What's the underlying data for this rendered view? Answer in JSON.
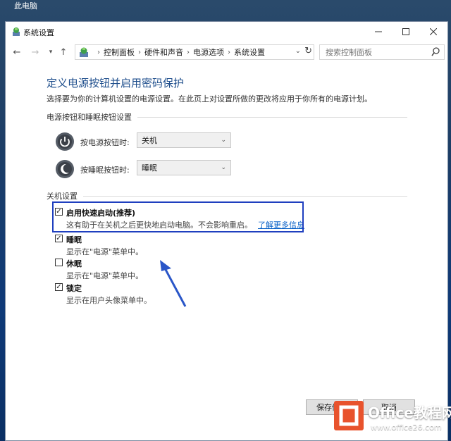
{
  "desktop": {
    "label": "此电脑"
  },
  "window": {
    "title": "系统设置",
    "breadcrumbs": [
      "控制面板",
      "硬件和声音",
      "电源选项",
      "系统设置"
    ],
    "search_placeholder": "搜索控制面板"
  },
  "page": {
    "title": "定义电源按钮并启用密码保护",
    "description": "选择要为你的计算机设置的电源设置。在此页上对设置所做的更改将应用于你所有的电源计划。"
  },
  "power_section": {
    "header": "电源按钮和睡眠按钮设置",
    "rows": [
      {
        "label": "按电源按钮时:",
        "value": "关机"
      },
      {
        "label": "按睡眠按钮时:",
        "value": "睡眠"
      }
    ]
  },
  "shutdown_section": {
    "header": "关机设置",
    "options": [
      {
        "title": "启用快速启动(推荐)",
        "desc": "这有助于在关机之后更快地启动电脑。不会影响重启。",
        "link": "了解更多信息",
        "checked": true
      },
      {
        "title": "睡眠",
        "desc": "显示在\"电源\"菜单中。",
        "checked": true
      },
      {
        "title": "休眠",
        "desc": "显示在\"电源\"菜单中。",
        "checked": false
      },
      {
        "title": "锁定",
        "desc": "显示在用户头像菜单中。",
        "checked": true
      }
    ]
  },
  "footer": {
    "save": "保存修改",
    "cancel": "取消"
  },
  "watermark": {
    "brand": "Office教程网",
    "url": "www.office26.com"
  },
  "colors": {
    "accent": "#1e4e8c",
    "highlight": "#1f3fbf",
    "link": "#0a62c8",
    "logo": "#e8532d"
  }
}
